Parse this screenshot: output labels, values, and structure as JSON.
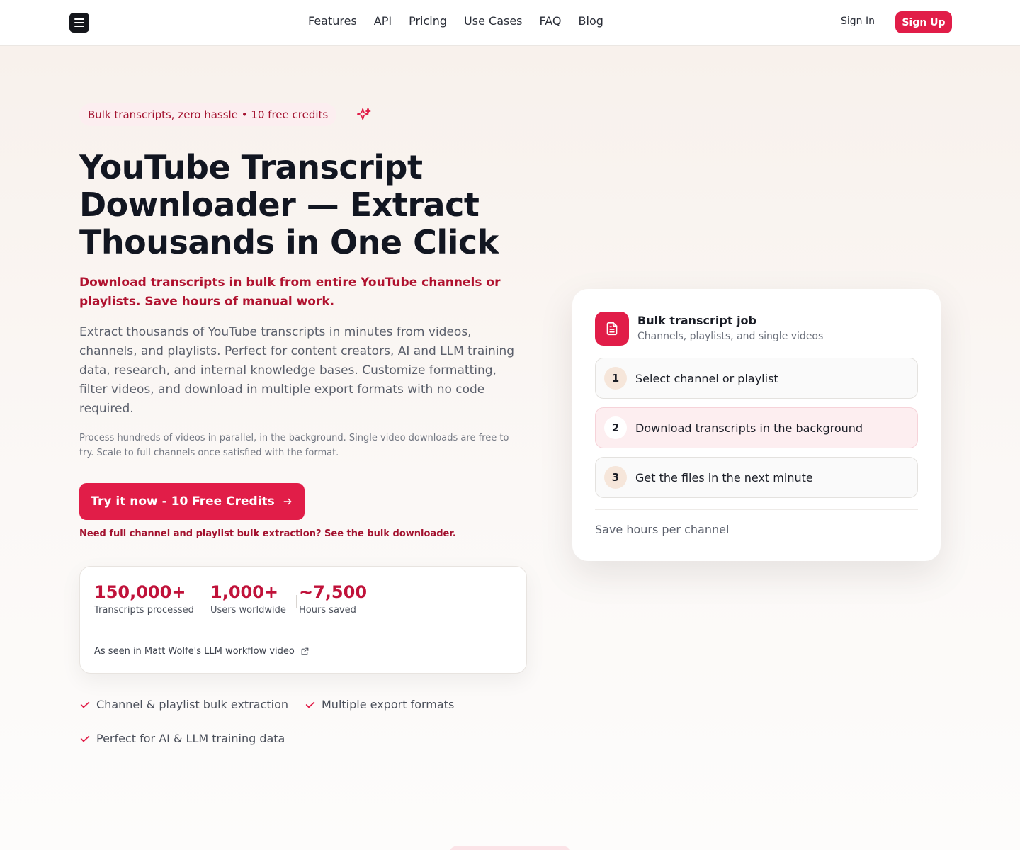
{
  "nav": {
    "links": [
      "Features",
      "API",
      "Pricing",
      "Use Cases",
      "FAQ",
      "Blog"
    ],
    "sign_in": "Sign In",
    "sign_up": "Sign Up"
  },
  "hero": {
    "badge": "Bulk transcripts, zero hassle • 10 free credits",
    "title": "YouTube Transcript Downloader — Extract Thousands in One Click",
    "lead": "Download transcripts in bulk from entire YouTube channels or playlists. Save hours of manual work.",
    "body": "Extract thousands of YouTube transcripts in minutes from videos, channels, and playlists. Perfect for content creators, AI and LLM training data, research, and internal knowledge bases. Customize formatting, filter videos, and download in multiple export formats with no code required.",
    "small": "Process hundreds of videos in parallel, in the background. Single video downloads are free to try. Scale to full channels once satisfied with the format.",
    "cta": "Try it now - 10 Free Credits",
    "cta_note": "Need full channel and playlist bulk extraction? See the bulk downloader."
  },
  "stats": {
    "items": [
      {
        "value": "150,000+",
        "label": "Transcripts processed"
      },
      {
        "value": "1,000+",
        "label": "Users worldwide"
      },
      {
        "value": "~7,500",
        "label": "Hours saved"
      }
    ],
    "seen_in": "As seen in Matt Wolfe's LLM workflow video"
  },
  "features": [
    "Channel & playlist bulk extraction",
    "Multiple export formats",
    "Perfect for AI & LLM training data"
  ],
  "job_card": {
    "title": "Bulk transcript job",
    "subtitle": "Channels, playlists, and single videos",
    "steps": [
      {
        "num": "1",
        "label": "Select channel or playlist"
      },
      {
        "num": "2",
        "label": "Download transcripts in the background"
      },
      {
        "num": "3",
        "label": "Get the files in the next minute"
      }
    ],
    "footer": "Save hours per channel"
  },
  "colors": {
    "accent": "#e11d48",
    "accent_dark": "#a3122f"
  },
  "icons": {
    "menu": "menu-icon",
    "sparkle": "sparkle-icon",
    "arrow": "arrow-right-icon",
    "external": "external-link-icon",
    "check": "check-icon",
    "document": "document-icon"
  }
}
